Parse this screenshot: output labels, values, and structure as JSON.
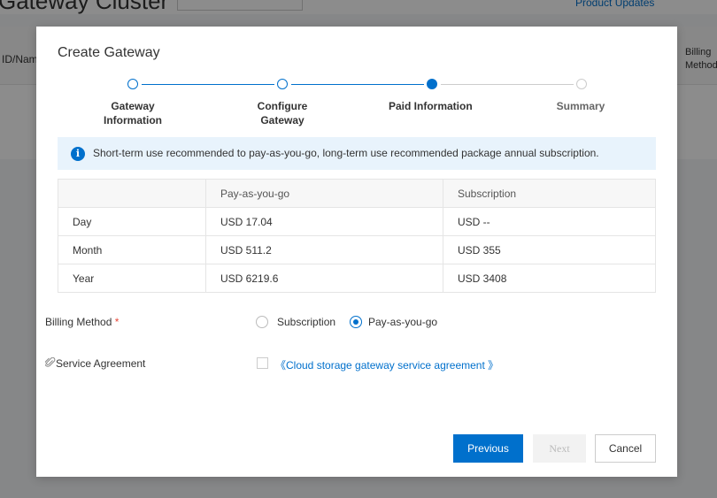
{
  "background": {
    "page_title": "Gateway Cluster",
    "header_link": "Product Updates",
    "col_left": "ID/Name",
    "col_right": "Billing Method"
  },
  "dialog": {
    "title": "Create Gateway",
    "steps": [
      {
        "label": "Gateway Information",
        "status": "done"
      },
      {
        "label": "Configure Gateway",
        "status": "done"
      },
      {
        "label": "Paid Information",
        "status": "active"
      },
      {
        "label": "Summary",
        "status": "pending"
      }
    ],
    "info": {
      "icon": "info-icon",
      "text": "Short-term use recommended to pay-as-you-go, long-term use recommended package annual subscription."
    },
    "price_table": {
      "headers": [
        "",
        "Pay-as-you-go",
        "Subscription"
      ],
      "rows": [
        [
          "Day",
          "USD 17.04",
          "USD --"
        ],
        [
          "Month",
          "USD 511.2",
          "USD 355"
        ],
        [
          "Year",
          "USD 6219.6",
          "USD 3408"
        ]
      ]
    },
    "billing": {
      "label": "Billing Method",
      "required_mark": "*",
      "options": [
        {
          "label": "Subscription",
          "checked": false
        },
        {
          "label": "Pay-as-you-go",
          "checked": true
        }
      ]
    },
    "agreement": {
      "label": "Service Agreement",
      "icon": "paperclip-icon",
      "link": "《Cloud storage gateway service agreement 》",
      "checked": false
    },
    "buttons": {
      "previous": "Previous",
      "next": "Next",
      "cancel": "Cancel"
    }
  },
  "colors": {
    "accent": "#0070cc",
    "required": "#e84738",
    "info_bg": "#e8f3fc"
  }
}
